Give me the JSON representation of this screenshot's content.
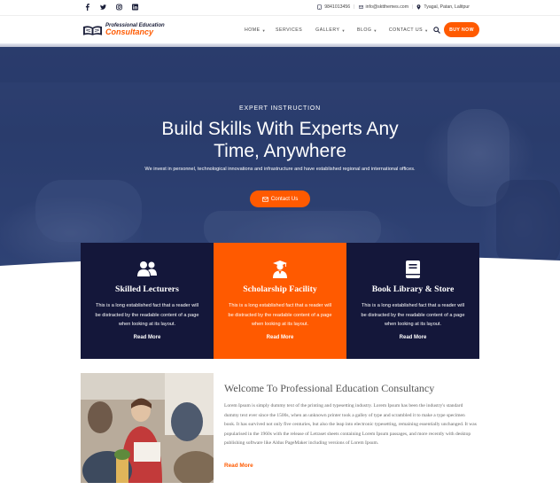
{
  "topbar": {
    "social_icons": [
      "facebook-icon",
      "twitter-icon",
      "instagram-icon",
      "linkedin-icon"
    ],
    "phone": "9841013456",
    "email": "info@sktthemes.com",
    "location": "Tyagal, Patan, Lalitpur"
  },
  "header": {
    "logo_line1": "Professional Education",
    "logo_line2": "Consultancy",
    "nav": [
      {
        "label": "HOME",
        "dropdown": true
      },
      {
        "label": "SERVICES",
        "dropdown": false
      },
      {
        "label": "GALLERY",
        "dropdown": true
      },
      {
        "label": "BLOG",
        "dropdown": true
      },
      {
        "label": "CONTACT US",
        "dropdown": true
      }
    ],
    "buy_label": "BUY NOW"
  },
  "hero": {
    "kicker": "EXPERT INSTRUCTION",
    "title_line1": "Build Skills With Experts Any",
    "title_line2": "Time, Anywhere",
    "description": "We invest in personnel, technological innovations and infrastructure and have established regional and international offices.",
    "button_label": "Contact Us"
  },
  "features": [
    {
      "title": "Skilled Lecturers",
      "icon": "users-icon",
      "text": "This is a long established fact that a reader will be distracted by the readable content of a page when looking at its layout.",
      "link": "Read More"
    },
    {
      "title": "Scholarship Facility",
      "icon": "graduate-icon",
      "text": "This is a long established fact that a reader will be distracted by the readable content of a page when looking at its layout.",
      "link": "Read More"
    },
    {
      "title": "Book Library & Store",
      "icon": "book-icon",
      "text": "This is a long established fact that a reader will be distracted by the readable content of a page when looking at its layout.",
      "link": "Read More"
    }
  ],
  "welcome": {
    "title": "Welcome To Professional Education Consultancy",
    "text": "Lorem Ipsum is simply dummy text of the printing and typesetting industry. Lorem Ipsum has been the industry's standard dummy text ever since the 1500s, when an unknown printer took a galley of type and scrambled it to make a type specimen book. It has survived not only five centuries, but also the leap into electronic typesetting, remaining essentially unchanged. It was popularised in the 1960s with the release of Letraset sheets containing Lorem Ipsum passages, and more recently with desktop publishing software like Aldus PageMaker including versions of Lorem Ipsum.",
    "link": "Read More"
  },
  "colors": {
    "accent": "#ff5a00",
    "navy": "#14173a",
    "hero": "#34497c"
  }
}
